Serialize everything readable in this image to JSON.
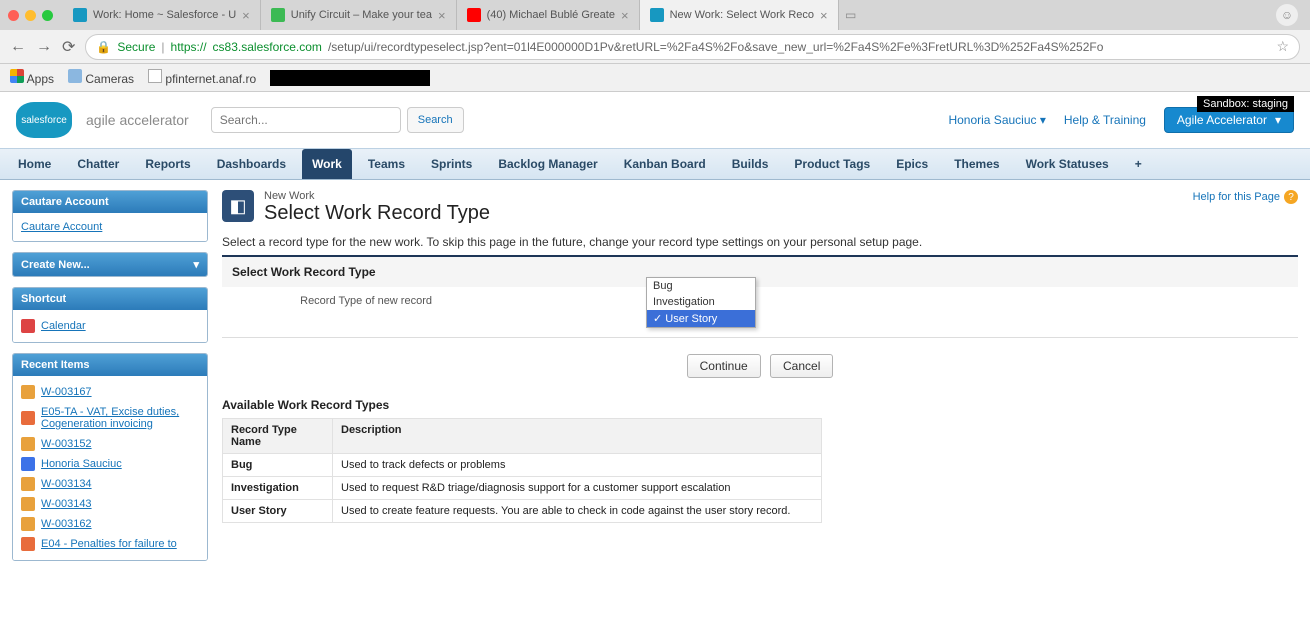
{
  "browser": {
    "tabs": [
      {
        "title": "Work: Home ~ Salesforce - U",
        "favicon": "#1798c1"
      },
      {
        "title": "Unify Circuit – Make your tea",
        "favicon": "#3cba54"
      },
      {
        "title": "(40) Michael Bublé Greate",
        "favicon": "#ff0000"
      },
      {
        "title": "New Work: Select Work Reco",
        "favicon": "#1798c1",
        "active": true
      }
    ],
    "secure_label": "Secure",
    "url_protocol": "https://",
    "url_host": "cs83.salesforce.com",
    "url_path": "/setup/ui/recordtypeselect.jsp?ent=01l4E000000D1Pv&retURL=%2Fa4S%2Fo&save_new_url=%2Fa4S%2Fe%3FretURL%3D%252Fa4S%252Fo",
    "bookmarks": {
      "apps": "Apps",
      "cameras": "Cameras",
      "pfi": "pfinternet.anaf.ro"
    }
  },
  "header": {
    "logo_text": "salesforce",
    "app_name": "agile accelerator",
    "search_placeholder": "Search...",
    "search_button": "Search",
    "user_name": "Honoria Sauciuc",
    "help_label": "Help & Training",
    "accel_button": "Agile Accelerator",
    "sandbox_badge": "Sandbox:   staging"
  },
  "nav": {
    "items": [
      "Home",
      "Chatter",
      "Reports",
      "Dashboards",
      "Work",
      "Teams",
      "Sprints",
      "Backlog Manager",
      "Kanban Board",
      "Builds",
      "Product Tags",
      "Epics",
      "Themes",
      "Work Statuses"
    ],
    "active_index": 4,
    "plus": "+"
  },
  "sidebar": {
    "search_head": "Cautare Account",
    "search_link": "Cautare Account",
    "create_head": "Create New...",
    "shortcut_head": "Shortcut",
    "calendar": "Calendar",
    "recent_head": "Recent Items",
    "recent": [
      {
        "label": "W-003167",
        "color": "#e8a13c"
      },
      {
        "label": "E05-TA - VAT, Excise duties, Cogeneration invoicing",
        "color": "#e86c3c"
      },
      {
        "label": "W-003152",
        "color": "#e8a13c"
      },
      {
        "label": "Honoria Sauciuc",
        "color": "#3c72e8"
      },
      {
        "label": "W-003134",
        "color": "#e8a13c"
      },
      {
        "label": "W-003143",
        "color": "#e8a13c"
      },
      {
        "label": "W-003162",
        "color": "#e8a13c"
      },
      {
        "label": "E04 - Penalties for failure to",
        "color": "#e86c3c"
      }
    ]
  },
  "main": {
    "breadcrumb": "New Work",
    "title": "Select Work Record Type",
    "help_label": "Help for this Page",
    "intro": "Select a record type for the new work. To skip this page in the future, change your record type settings on your personal setup page.",
    "panel_head": "Select Work Record Type",
    "field_label": "Record Type of new record",
    "dropdown": {
      "options": [
        "Bug",
        "Investigation",
        "User Story"
      ],
      "selected_index": 2
    },
    "continue": "Continue",
    "cancel": "Cancel",
    "avail_head": "Available Work Record Types",
    "table": {
      "col_name": "Record Type Name",
      "col_desc": "Description",
      "rows": [
        {
          "name": "Bug",
          "desc": "Used to track defects or problems"
        },
        {
          "name": "Investigation",
          "desc": "Used to request R&D triage/diagnosis support for a customer support escalation"
        },
        {
          "name": "User Story",
          "desc": "Used to create feature requests. You are able to check in code against the user story record."
        }
      ]
    }
  }
}
